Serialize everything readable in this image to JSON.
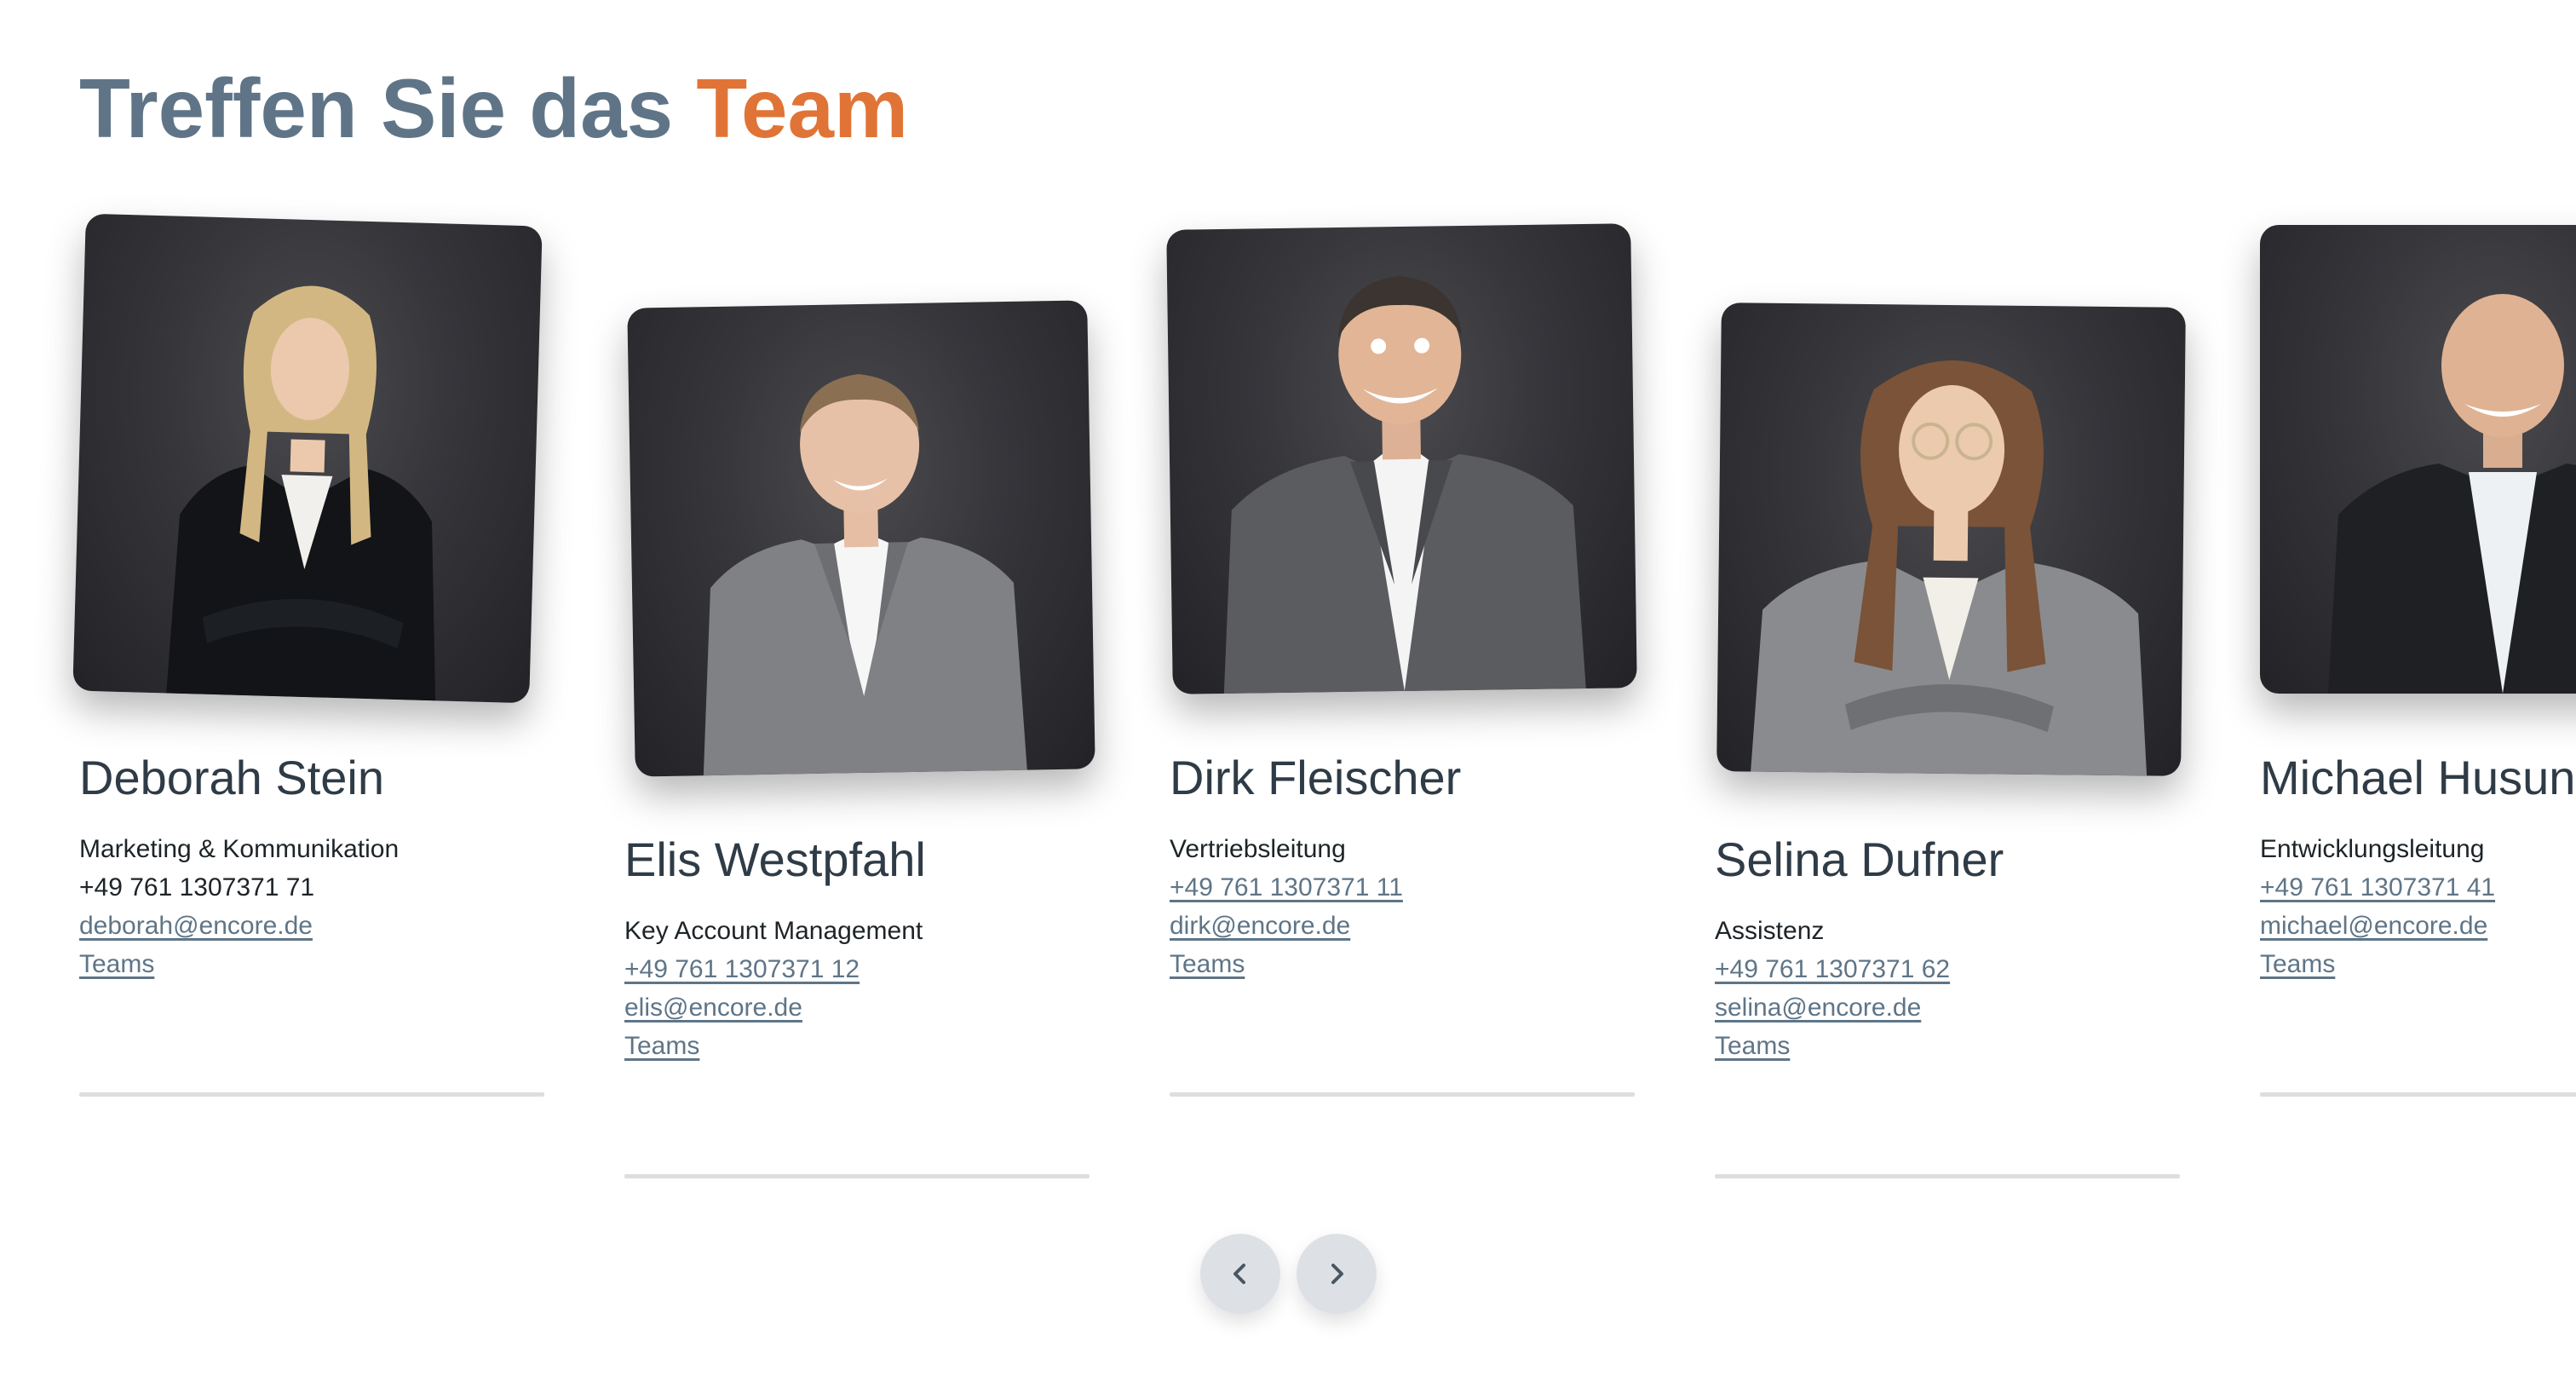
{
  "section": {
    "title_main": "Treffen Sie das ",
    "title_accent": "Team"
  },
  "colors": {
    "title": "#5f7587",
    "accent": "#e07436",
    "link": "#5f7587",
    "name": "#2f3b46",
    "divider": "#dcdee0",
    "nav_button": "#dde1e5"
  },
  "team": [
    {
      "name": "Deborah Stein",
      "role": "Marketing & Kommunikation",
      "phone": "+49 761 1307371 71",
      "email": "deborah@encore.de",
      "teams": "Teams"
    },
    {
      "name": "Elis Westpfahl",
      "role": "Key Account Management",
      "phone": "+49 761 1307371 12",
      "email": "elis@encore.de",
      "teams": "Teams"
    },
    {
      "name": "Dirk Fleischer",
      "role": "Vertriebsleitung",
      "phone": "+49 761 1307371 11",
      "email": "dirk@encore.de",
      "teams": "Teams"
    },
    {
      "name": "Selina Dufner",
      "role": "Assistenz",
      "phone": "+49 761 1307371 62",
      "email": "selina@encore.de",
      "teams": "Teams"
    },
    {
      "name": "Michael Husun",
      "role": "Entwicklungsleitung",
      "phone": "+49 761 1307371 41",
      "email": "michael@encore.de",
      "teams": "Teams"
    }
  ],
  "navigation": {
    "prev_icon": "chevron-left-icon",
    "next_icon": "chevron-right-icon"
  }
}
